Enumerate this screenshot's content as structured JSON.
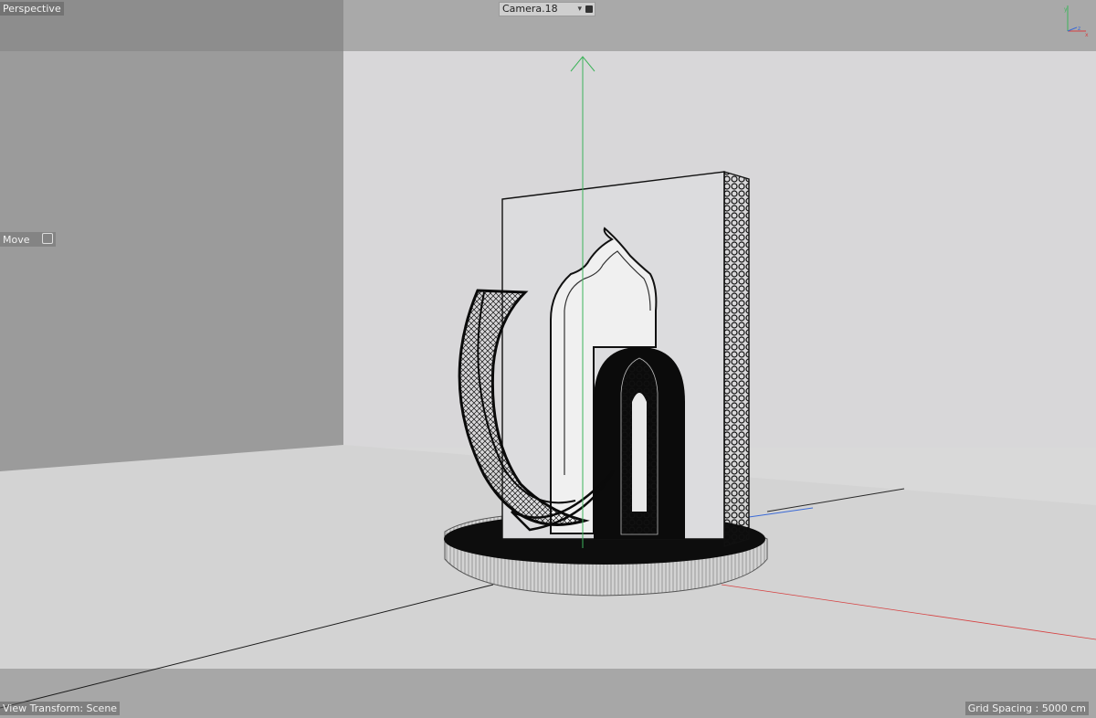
{
  "viewport": {
    "view_name": "Perspective",
    "camera": "Camera.18",
    "tool": "Move",
    "view_transform": "View Transform: Scene",
    "grid_spacing": "Grid Spacing : 5000 cm"
  },
  "gizmo_axes": [
    "y",
    "z",
    "x"
  ],
  "colors": {
    "background_wall": "#9a9a9a",
    "floor": "#d2d2d2",
    "axis_x": "#d64040",
    "axis_y": "#3db35a",
    "axis_z": "#3b6ad6"
  }
}
